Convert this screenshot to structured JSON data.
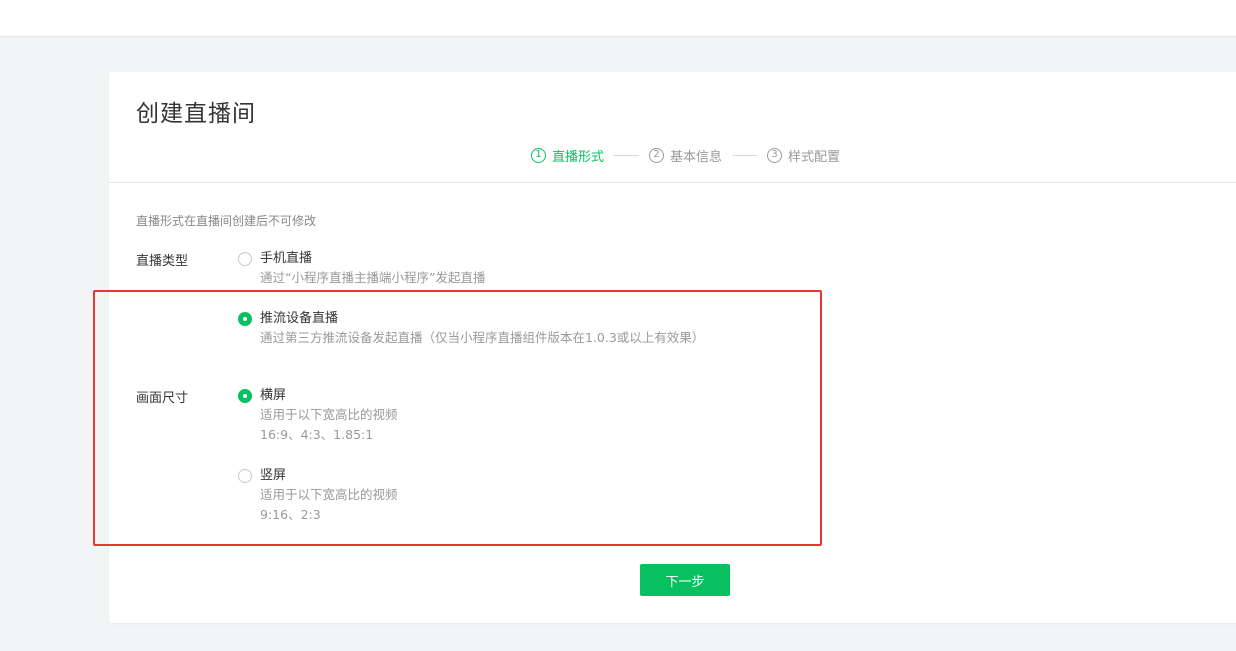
{
  "page": {
    "title": "创建直播间"
  },
  "steps": [
    {
      "num": "1",
      "label": "直播形式",
      "active": true
    },
    {
      "num": "2",
      "label": "基本信息",
      "active": false
    },
    {
      "num": "3",
      "label": "样式配置",
      "active": false
    }
  ],
  "hint": "直播形式在直播间创建后不可修改",
  "live_type": {
    "label": "直播类型",
    "options": [
      {
        "title": "手机直播",
        "desc": [
          "通过“小程序直播主播端小程序”发起直播"
        ],
        "checked": false
      },
      {
        "title": "推流设备直播",
        "desc": [
          "通过第三方推流设备发起直播（仅当小程序直播组件版本在1.0.3或以上有效果）"
        ],
        "checked": true
      }
    ]
  },
  "screen_size": {
    "label": "画面尺寸",
    "options": [
      {
        "title": "横屏",
        "desc": [
          "适用于以下宽高比的视频",
          "16:9、4:3、1.85:1"
        ],
        "checked": true
      },
      {
        "title": "竖屏",
        "desc": [
          "适用于以下宽高比的视频",
          "9:16、2:3"
        ],
        "checked": false
      }
    ]
  },
  "next_button": "下一步",
  "colors": {
    "accent": "#07c160",
    "highlight_box": "#e53935"
  }
}
